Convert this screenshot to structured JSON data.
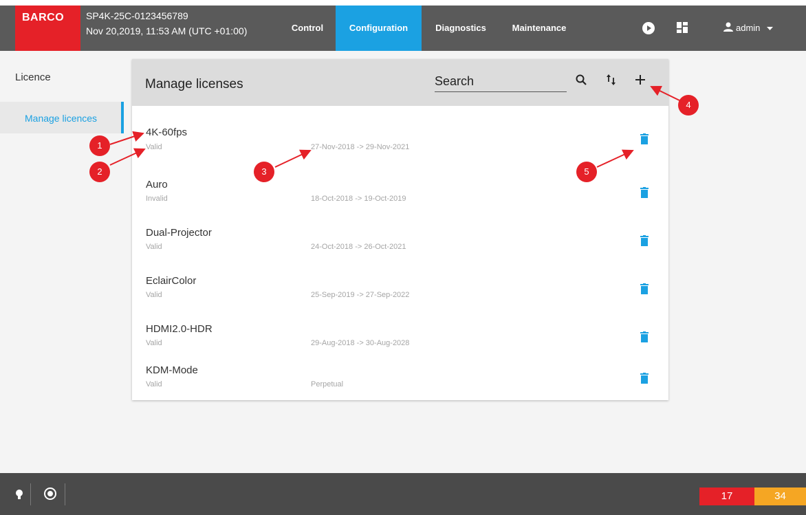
{
  "topbar": {
    "logo_text": "BARCO",
    "device_name": "SP4K-25C-0123456789",
    "device_datetime": "Nov 20,2019, 11:53 AM (UTC +01:00)",
    "nav_tabs": [
      {
        "label": "Control",
        "active": false
      },
      {
        "label": "Configuration",
        "active": true
      },
      {
        "label": "Diagnostics",
        "active": false
      },
      {
        "label": "Maintenance",
        "active": false
      }
    ],
    "icons": [
      "play-icon",
      "dashboard-icon"
    ],
    "user_label": "admin",
    "accent_color": "#1ba1e2",
    "brand_color": "#e52128"
  },
  "sidebar": {
    "heading": "Licence",
    "items": [
      {
        "label": "Manage licences",
        "active": true
      }
    ]
  },
  "panel": {
    "title": "Manage licenses",
    "search_placeholder": "Search",
    "licenses": [
      {
        "name": "4K-60fps",
        "status": "Valid",
        "period": "27-Nov-2018 -> 29-Nov-2021"
      },
      {
        "name": "Auro",
        "status": "Invalid",
        "period": "18-Oct-2018 -> 19-Oct-2019"
      },
      {
        "name": "Dual-Projector",
        "status": "Valid",
        "period": "24-Oct-2018 -> 26-Oct-2021"
      },
      {
        "name": "EclairColor",
        "status": "Valid",
        "period": "25-Sep-2019 -> 27-Sep-2022"
      },
      {
        "name": "HDMI2.0-HDR",
        "status": "Valid",
        "period": "29-Aug-2018 -> 30-Aug-2028"
      },
      {
        "name": "KDM-Mode",
        "status": "Valid",
        "period": "Perpetual"
      }
    ]
  },
  "callouts": [
    "1",
    "2",
    "3",
    "4",
    "5"
  ],
  "footer": {
    "error_count": "17",
    "warning_count": "34",
    "error_color": "#e52128",
    "warning_color": "#f5a623"
  }
}
